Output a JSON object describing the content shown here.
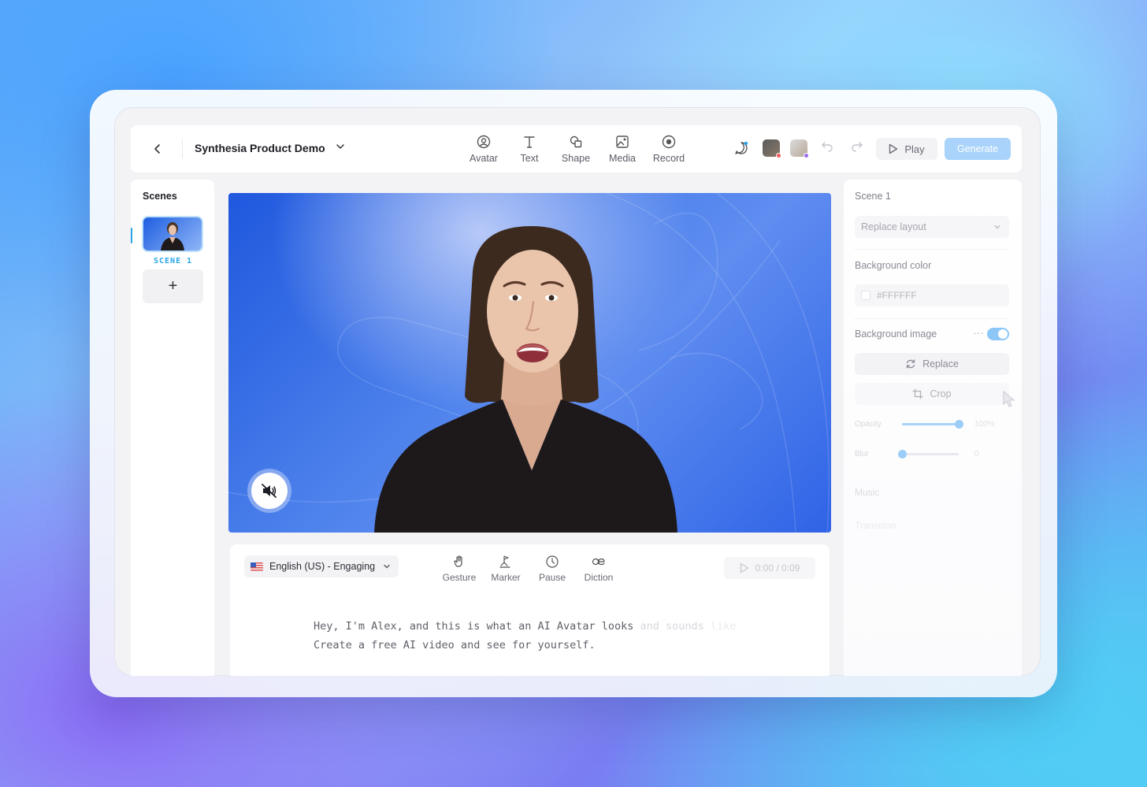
{
  "toolbar": {
    "doc_title": "Synthesia Product Demo",
    "tools": {
      "avatar": "Avatar",
      "text": "Text",
      "shape": "Shape",
      "media": "Media",
      "record": "Record"
    },
    "play_label": "Play",
    "generate_label": "Generate"
  },
  "scenes": {
    "title": "Scenes",
    "items": [
      {
        "label": "SCENE 1"
      }
    ],
    "add_symbol": "+"
  },
  "script": {
    "language": "English (US) - Engaging",
    "tools": {
      "gesture": "Gesture",
      "marker": "Marker",
      "pause": "Pause",
      "diction": "Diction"
    },
    "time": "0:00 / 0:09",
    "line1_main": "Hey, I'm Alex, and this is what an AI Avatar looks",
    "line1_fade": " and sounds",
    "line1_fade2": " like",
    "line2": "Create a free AI video and see for yourself."
  },
  "properties": {
    "title": "Scene 1",
    "layout_placeholder": "Replace layout",
    "bg_color_label": "Background color",
    "bg_color_value": "#FFFFFF",
    "bg_image_label": "Background image",
    "bg_image_enabled": true,
    "replace_label": "Replace",
    "crop_label": "Crop",
    "opacity_label": "Opacity",
    "opacity_value": "100%",
    "opacity_level": 100,
    "blur_label": "Blur",
    "blur_value": "0",
    "blur_level": 0,
    "music_label": "Music",
    "transition_label": "Transition"
  },
  "colors": {
    "accent": "#2aa5e8",
    "generate_bg": "#a9d3fb",
    "canvas_blue": "#2f63e6"
  }
}
